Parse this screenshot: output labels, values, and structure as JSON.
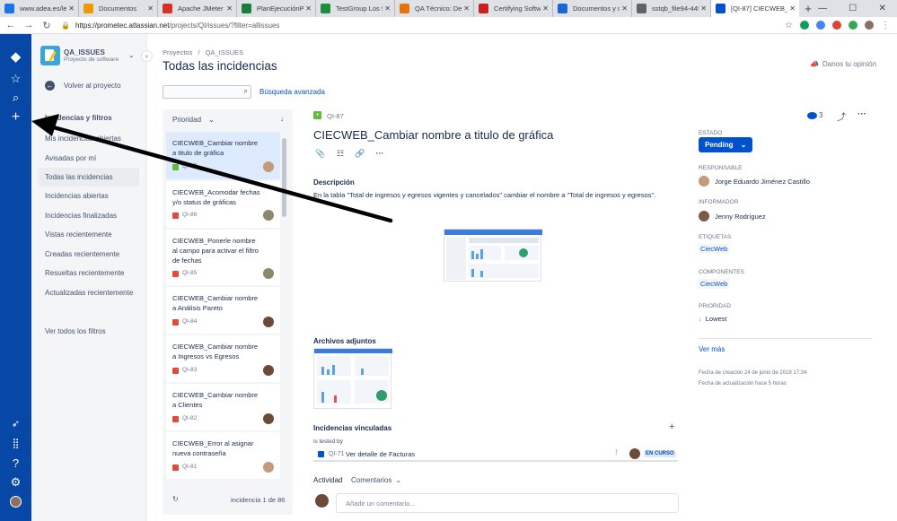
{
  "browser": {
    "tabs": [
      {
        "title": "www.adea.es/legal",
        "color": "#1a73e8"
      },
      {
        "title": "Documentos",
        "color": "#f29900"
      },
      {
        "title": "Apache JMeter - D",
        "color": "#d93025"
      },
      {
        "title": "PlanEjecuciónPrue",
        "color": "#188038"
      },
      {
        "title": "TestGroup Los 9 E",
        "color": "#1e8e3e"
      },
      {
        "title": "QA Técnico: Defini",
        "color": "#e8710a"
      },
      {
        "title": "Certifying Softwar",
        "color": "#c5221f"
      },
      {
        "title": "Documentos y de",
        "color": "#1967d2"
      },
      {
        "title": "sstqb_file94-4453",
        "color": "#5f6368"
      },
      {
        "title": "[QI-87] CIECWEB_",
        "color": "#0052cc"
      }
    ],
    "url_host": "https://prometec.atlassian.net",
    "url_path": "/projects/QI/issues/?filter=allissues"
  },
  "project": {
    "name": "QA_ISSUES",
    "type": "Proyecto de software",
    "back": "Volver al proyecto",
    "filters_heading": "Incidencias y filtros",
    "filters": [
      "Mis incidencias abiertas",
      "Avisadas por mí",
      "Todas las incidencias",
      "Incidencias abiertas",
      "Incidencias finalizadas",
      "Vistas recientemente",
      "Creadas recientemente",
      "Resueltas recientemente",
      "Actualizadas recientemente"
    ],
    "view_all": "Ver todos los filtros"
  },
  "main": {
    "breadcrumb_1": "Proyectos",
    "breadcrumb_sep": "/",
    "breadcrumb_2": "QA_ISSUES",
    "title": "Todas las incidencias",
    "feedback": "Danos tu opinión",
    "search_placeholder": "",
    "advanced_search": "Búsqueda avanzada"
  },
  "issue_list": {
    "sort_label": "Prioridad",
    "items": [
      {
        "summary": "CIECWEB_Cambiar nombre a titulo de gráfica",
        "key": "QI-87",
        "type_color": "#63ba3c"
      },
      {
        "summary": "CIECWEB_Acomodar fechas y/o status de gráficas",
        "key": "QI-86",
        "type_color": "#e5493a"
      },
      {
        "summary": "CIECWEB_Ponerle nombre al campo para activar el filtro de fechas",
        "key": "QI-85",
        "type_color": "#e5493a"
      },
      {
        "summary": "CIECWEB_Cambiar nombre a Análisis Pareto",
        "key": "QI-84",
        "type_color": "#e5493a"
      },
      {
        "summary": "CIECWEB_Cambiar nombre a Ingresos vs Egresos",
        "key": "QI-83",
        "type_color": "#e5493a"
      },
      {
        "summary": "CIECWEB_Cambiar nombre a Clientes",
        "key": "QI-82",
        "type_color": "#e5493a"
      },
      {
        "summary": "CIECWEB_Error al asignar nueva contraseña",
        "key": "QI-81",
        "type_color": "#e5493a"
      }
    ],
    "footer": "incidencia 1 de 86"
  },
  "issue": {
    "key": "QI-87",
    "title": "CIECWEB_Cambiar nombre a titulo de gráfica",
    "description_label": "Descripción",
    "description": "En la tabla \"Total de ingresos y egresos vigentes y cancelados\" cambiar el nombre a \"Total de ingresos y egresos\".",
    "attachments_label": "Archivos adjuntos",
    "linked_label": "Incidencias vinculadas",
    "link_type": "is tested by",
    "linked_key": "QI-71",
    "linked_summary": "Ver detalle de Facturas",
    "linked_status": "EN CURSO",
    "activity_label": "Actividad",
    "activity_filter": "Comentarios",
    "comment_placeholder": "Añadir un comentario..."
  },
  "details": {
    "watchers": "3",
    "status_label": "ESTADO",
    "status": "Pending",
    "assignee_label": "RESPONSABLE",
    "assignee": "Jorge Eduardo Jiménez Castillo",
    "reporter_label": "INFORMADOR",
    "reporter": "Jenny Rodríguez",
    "labels_label": "ETIQUETAS",
    "label": "CiecWeb",
    "components_label": "COMPONENTES",
    "component": "CiecWeb",
    "priority_label": "PRIORIDAD",
    "priority": "Lowest",
    "more": "Ver más",
    "created": "Fecha de creación 24 de junio de 2019 17:34",
    "updated": "Fecha de actualización hace 5 horas"
  },
  "colors": {
    "global_nav": "#0747a6",
    "accent": "#0052cc"
  }
}
